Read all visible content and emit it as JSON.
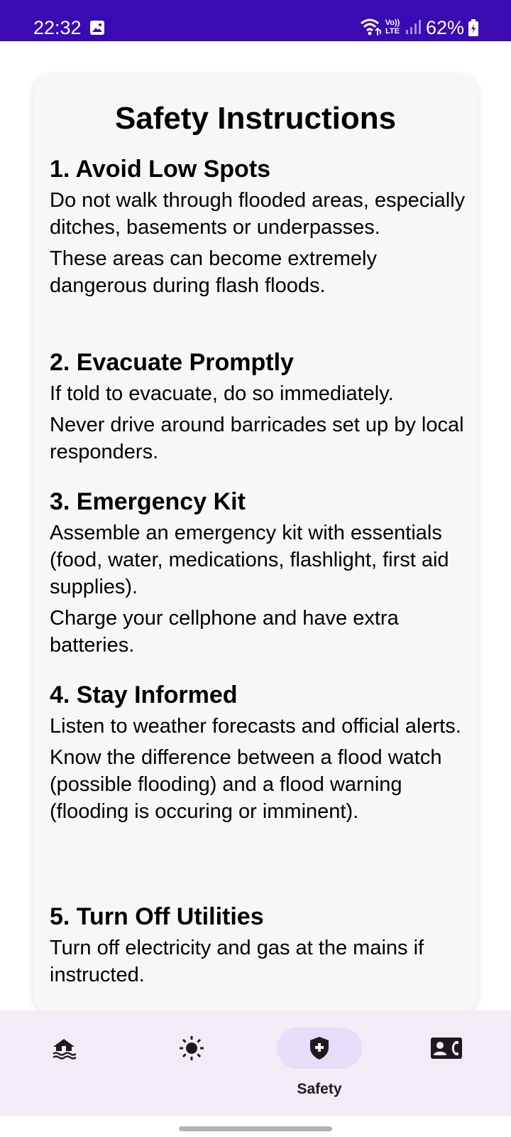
{
  "status_bar": {
    "time": "22:32",
    "volte": "Vo)) LTE",
    "battery": "62%",
    "icons": [
      "gallery-icon",
      "wifi-icon",
      "volte-icon",
      "signal-icon",
      "battery-charging-icon"
    ]
  },
  "card": {
    "title": "Safety Instructions",
    "sections": [
      {
        "title": "1. Avoid Low Spots",
        "paragraphs": [
          "Do not walk through flooded areas, especially ditches, basements or underpasses.",
          "These areas can become extremely dangerous during flash floods."
        ]
      },
      {
        "title": "2. Evacuate Promptly",
        "paragraphs": [
          "If told to evacuate, do so immediately.",
          "Never drive around barricades set up by local responders."
        ]
      },
      {
        "title": "3. Emergency Kit",
        "paragraphs": [
          "Assemble an emergency kit with essentials (food, water, medications, flashlight, first aid supplies).",
          "Charge your cellphone and have extra batteries."
        ]
      },
      {
        "title": "4. Stay Informed",
        "paragraphs": [
          "Listen to weather forecasts and official alerts.",
          "Know the difference between a flood watch (possible flooding) and a flood warning (flooding is occuring or imminent)."
        ]
      },
      {
        "title": "5. Turn Off Utilities",
        "paragraphs": [
          "Turn off electricity and gas at the mains if instructed."
        ]
      }
    ]
  },
  "bottom_nav": {
    "items": [
      {
        "icon": "flood-icon",
        "label": "",
        "active": false
      },
      {
        "icon": "sun-icon",
        "label": "",
        "active": false
      },
      {
        "icon": "shield-plus-icon",
        "label": "Safety",
        "active": true
      },
      {
        "icon": "contact-phone-icon",
        "label": "",
        "active": false
      }
    ]
  },
  "colors": {
    "status_bar": "#3a0ab2",
    "card_background": "#f8f7f5",
    "nav_background": "#f2ecf6",
    "active_indicator": "#e7ddf8",
    "icon": "#1d1b20"
  }
}
